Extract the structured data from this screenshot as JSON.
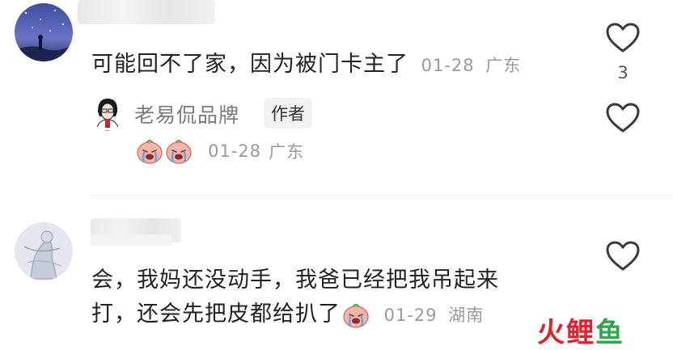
{
  "comments": [
    {
      "text": "可能回不了家，因为被门卡主了",
      "date": "01-28",
      "location": "广东",
      "like_count": "3",
      "reply": {
        "author": "老易侃品牌",
        "badge": "作者",
        "date": "01-28",
        "location": "广东"
      }
    },
    {
      "text_line1": "会，我妈还没动手，我爸已经把我吊起来",
      "text_line2": "打，还会先把皮都给扒了",
      "date": "01-29",
      "location": "湖南"
    }
  ],
  "watermark": {
    "char1": "火",
    "char2": "鲤",
    "char3": "鱼"
  },
  "colors": {
    "meta": "#9a9a9a",
    "watermark_red": "#e5202a",
    "watermark_green": "#2fa64a"
  },
  "icons": [
    "heart-outline-icon",
    "crying-face-emoji"
  ]
}
